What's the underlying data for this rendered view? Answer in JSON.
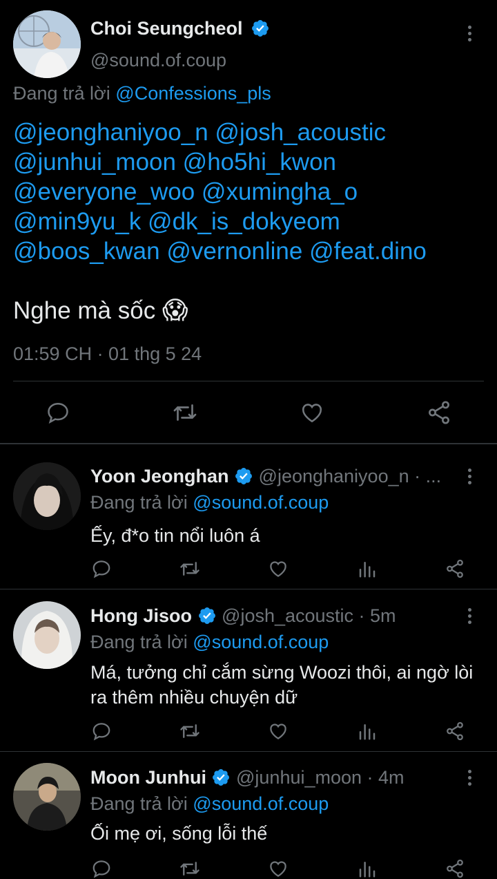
{
  "main_tweet": {
    "name": "Choi Seungcheol",
    "handle": "@sound.of.coup",
    "replying_prefix": "Đang trả lời",
    "replying_to": "@Confessions_pls",
    "mentions": [
      "@jeonghaniyoo_n @josh_acoustic",
      "@junhui_moon @ho5hi_kwon",
      "@everyone_woo @xumingha_o",
      "@min9yu_k @dk_is_dokyeom",
      "@boos_kwan @vernonline @feat.dino"
    ],
    "text": "Nghe mà sốc",
    "emoji": "😱",
    "timestamp": "01:59 CH · 01 thg 5 24",
    "actions": [
      "reply-icon",
      "retweet-icon",
      "like-icon",
      "share-icon"
    ]
  },
  "replies": [
    {
      "name": "Yoon Jeonghan",
      "meta": "@jeonghaniyoo_n · ...",
      "replying_prefix": "Đang trả lời",
      "replying_to": "@sound.of.coup",
      "text": "Ếy, đ*o tin nổi luôn á"
    },
    {
      "name": "Hong Jisoo",
      "meta": "@josh_acoustic · 5m",
      "replying_prefix": "Đang trả lời",
      "replying_to": "@sound.of.coup",
      "text": "Má, tưởng chỉ cắm sừng Woozi thôi, ai ngờ lòi ra thêm nhiều chuyện dữ"
    },
    {
      "name": "Moon Junhui",
      "meta": "@junhui_moon · 4m",
      "replying_prefix": "Đang trả lời",
      "replying_to": "@sound.of.coup",
      "text": "Ối mẹ ơi, sống lỗi thế"
    }
  ],
  "colors": {
    "background": "#000000",
    "text": "#e7e9ea",
    "secondary": "#71767b",
    "accent": "#1d9bf0",
    "divider": "#2f3336"
  }
}
